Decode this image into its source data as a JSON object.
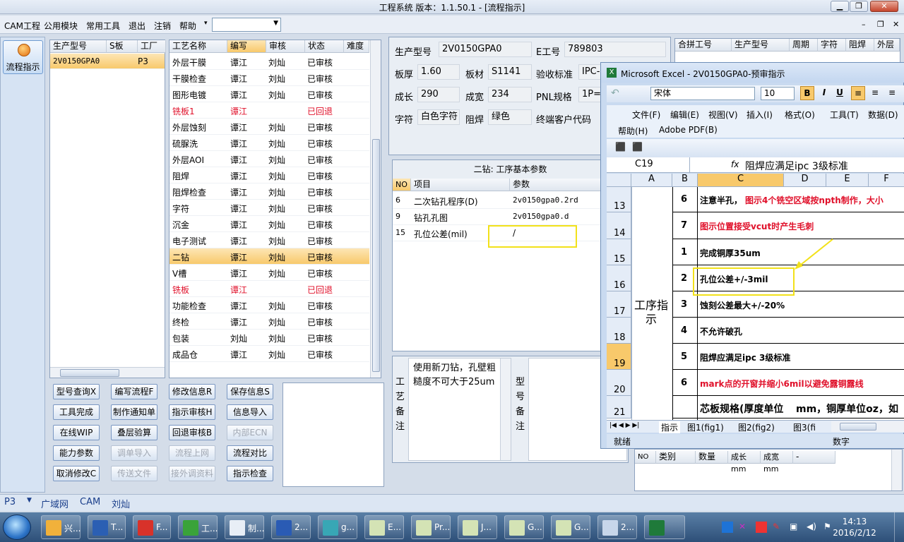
{
  "window": {
    "title": "工程系统   版本：1.1.50.1 - [流程指示]",
    "blurred_left": ""
  },
  "menu": {
    "items": [
      "CAM工程",
      "公用模块",
      "常用工具",
      "退出",
      "注销",
      "帮助"
    ],
    "combo_value": ""
  },
  "leftbar": {
    "flow_btn": "流程指示"
  },
  "prod_list": {
    "headers": [
      "生产型号",
      "S板",
      "工厂"
    ],
    "rows": [
      {
        "model": "2V0150GPA0",
        "s": "",
        "factory": "P3"
      }
    ]
  },
  "process_list": {
    "headers": [
      "工艺名称",
      "编写",
      "审核",
      "状态",
      "难度"
    ],
    "rows": [
      {
        "name": "外层干膜",
        "writer": "谭江",
        "reviewer": "刘灿",
        "status": "已审核",
        "red": false
      },
      {
        "name": "干膜检查",
        "writer": "谭江",
        "reviewer": "刘灿",
        "status": "已审核",
        "red": false
      },
      {
        "name": "图形电镀",
        "writer": "谭江",
        "reviewer": "刘灿",
        "status": "已审核",
        "red": false
      },
      {
        "name": "铣板1",
        "writer": "谭江",
        "reviewer": "",
        "status": "已回退",
        "red": true
      },
      {
        "name": "外层蚀刻",
        "writer": "谭江",
        "reviewer": "刘灿",
        "status": "已审核",
        "red": false
      },
      {
        "name": "硫脲洗",
        "writer": "谭江",
        "reviewer": "刘灿",
        "status": "已审核",
        "red": false
      },
      {
        "name": "外层AOI",
        "writer": "谭江",
        "reviewer": "刘灿",
        "status": "已审核",
        "red": false
      },
      {
        "name": "阻焊",
        "writer": "谭江",
        "reviewer": "刘灿",
        "status": "已审核",
        "red": false
      },
      {
        "name": "阻焊检查",
        "writer": "谭江",
        "reviewer": "刘灿",
        "status": "已审核",
        "red": false
      },
      {
        "name": "字符",
        "writer": "谭江",
        "reviewer": "刘灿",
        "status": "已审核",
        "red": false
      },
      {
        "name": "沉金",
        "writer": "谭江",
        "reviewer": "刘灿",
        "status": "已审核",
        "red": false
      },
      {
        "name": "电子测试",
        "writer": "谭江",
        "reviewer": "刘灿",
        "status": "已审核",
        "red": false
      },
      {
        "name": "二钻",
        "writer": "谭江",
        "reviewer": "刘灿",
        "status": "已审核",
        "red": false
      },
      {
        "name": "V槽",
        "writer": "谭江",
        "reviewer": "刘灿",
        "status": "已审核",
        "red": false
      },
      {
        "name": "铣板",
        "writer": "谭江",
        "reviewer": "",
        "status": "已回退",
        "red": true
      },
      {
        "name": "功能检查",
        "writer": "谭江",
        "reviewer": "刘灿",
        "status": "已审核",
        "red": false
      },
      {
        "name": "终检",
        "writer": "谭江",
        "reviewer": "刘灿",
        "status": "已审核",
        "red": false
      },
      {
        "name": "包装",
        "writer": "刘灿",
        "reviewer": "刘灿",
        "status": "已审核",
        "red": false
      },
      {
        "name": "成品仓",
        "writer": "谭江",
        "reviewer": "刘灿",
        "status": "已审核",
        "red": false
      }
    ]
  },
  "buttons": [
    [
      "型号查询X",
      "编写流程F",
      "修改信息R",
      "保存信息S"
    ],
    [
      "工具完成",
      "制作通知单",
      "指示审核H",
      "信息导入"
    ],
    [
      "在线WIP",
      "叠层验算",
      "回退审核B",
      "内部ECN"
    ],
    [
      "能力参数",
      "调单导入",
      "流程上网",
      "流程对比"
    ],
    [
      "取消修改C",
      "传送文件",
      "接外调资料",
      "指示检查"
    ]
  ],
  "disabled_buttons": [
    "内部ECN",
    "调单导入",
    "流程上网",
    "传送文件",
    "接外调资料"
  ],
  "info": {
    "fields": [
      {
        "label": "生产型号",
        "value": "2V0150GPA0"
      },
      {
        "label": "E工号",
        "value": "789803"
      },
      {
        "label": "板厚",
        "value": "1.60"
      },
      {
        "label": "板材",
        "value": "S1141"
      },
      {
        "label": "验收标准",
        "value": "IPC-"
      },
      {
        "label": "成长",
        "value": "290"
      },
      {
        "label": "成宽",
        "value": "234"
      },
      {
        "label": "PNL规格",
        "value": "1P="
      },
      {
        "label": "字符",
        "value": "白色字符"
      },
      {
        "label": "阻焊",
        "value": "绿色"
      },
      {
        "label": "终端客户代码",
        "value": ""
      }
    ]
  },
  "param_table": {
    "title": "二钻: 工序基本参数",
    "headers": [
      "NO",
      "项目",
      "参数"
    ],
    "rows": [
      {
        "no": "6",
        "item": "二次钻孔程序(D)",
        "param": "2v0150gpa0.2rd"
      },
      {
        "no": "9",
        "item": "钻孔孔图",
        "param": "2v0150gpa0.d"
      },
      {
        "no": "15",
        "item": "孔位公差(mil)",
        "param": "/"
      }
    ]
  },
  "notes": {
    "craft_label": "工艺备注",
    "craft_text": "使用新刀钻，孔壁粗糙度不可大于25um",
    "model_label": "型号备注"
  },
  "right_table": {
    "headers": [
      "合拼工号",
      "生产型号",
      "周期",
      "字符",
      "阻焊",
      "外层"
    ]
  },
  "bottom_table": {
    "headers": [
      "NO",
      "类别",
      "数量",
      "成长mm",
      "成宽mm",
      "-"
    ]
  },
  "excel": {
    "title": "Microsoft Excel - 2V0150GPA0-预审指示",
    "font": "宋体",
    "size": "10",
    "menu1": [
      "文件(F)",
      "编辑(E)",
      "视图(V)",
      "插入(I)",
      "格式(O)",
      "工具(T)",
      "数据(D)"
    ],
    "menu2": [
      "帮助(H)",
      "Adobe PDF(B)"
    ],
    "name_box": "C19",
    "formula": "阻焊应满足ipc 3级标准",
    "columns": [
      "A",
      "B",
      "C",
      "D",
      "E",
      "F"
    ],
    "group_label": "工序指示",
    "rows": [
      {
        "row": "13",
        "num": "6",
        "text": "注意半孔，",
        "text2": "图示4个铣空区域按npth制作，大小",
        "red": false
      },
      {
        "row": "14",
        "num": "7",
        "text": "",
        "text2": "图示位置接受vcut时产生毛刺",
        "red": true
      },
      {
        "row": "15",
        "num": "1",
        "text": "完成铜厚35um",
        "text2": "",
        "red": false
      },
      {
        "row": "16",
        "num": "2",
        "text": "孔位公差+/-3mil",
        "text2": "",
        "red": false
      },
      {
        "row": "17",
        "num": "3",
        "text": "蚀刻公差最大+/-20%",
        "text2": "",
        "red": false
      },
      {
        "row": "18",
        "num": "4",
        "text": "不允许破孔",
        "text2": "",
        "red": false
      },
      {
        "row": "19",
        "num": "5",
        "text": "阻焊应满足ipc 3级标准",
        "text2": "",
        "red": false
      },
      {
        "row": "20",
        "num": "6",
        "text": "",
        "text2": "mark点的开窗并缩小6mil以避免露铜露线",
        "red": true
      },
      {
        "row": "21",
        "num": "",
        "text": "芯板规格(厚度单位",
        "text2": "mm，铜厚单位oz，如",
        "red": false
      }
    ],
    "sheet_tabs": [
      "指示",
      "图1(fig1)",
      "图2(fig2)",
      "图3(fi"
    ],
    "status_left": "就绪",
    "status_right": "数字"
  },
  "statusbar": {
    "items": [
      "P3",
      "广域网",
      "CAM",
      "刘灿"
    ]
  },
  "taskbar": {
    "items": [
      {
        "label": "兴...",
        "color": "#f1b13b"
      },
      {
        "label": "T...",
        "color": "#2b5fb3"
      },
      {
        "label": "F...",
        "color": "#d8322a"
      },
      {
        "label": "工...",
        "color": "#3aa33a"
      },
      {
        "label": "制...",
        "color": "#e8eef6"
      },
      {
        "label": "2...",
        "color": "#2a5bb4"
      },
      {
        "label": "g...",
        "color": "#38a7b5"
      },
      {
        "label": "E...",
        "color": "#d4e3b5"
      },
      {
        "label": "Pr...",
        "color": "#d4e3b5"
      },
      {
        "label": "J...",
        "color": "#d4e3b5"
      },
      {
        "label": "G...",
        "color": "#d4e3b5"
      },
      {
        "label": "G...",
        "color": "#d4e3b5"
      },
      {
        "label": "2...",
        "color": "#c7d6ea"
      },
      {
        "label": "",
        "color": "#1f7a3a"
      }
    ],
    "time": "14:13",
    "date": "2016/2/12"
  },
  "colors": {
    "accent_red": "#e0102a",
    "selection": "#f8c96b",
    "highlight_box": "#f2e11a"
  }
}
